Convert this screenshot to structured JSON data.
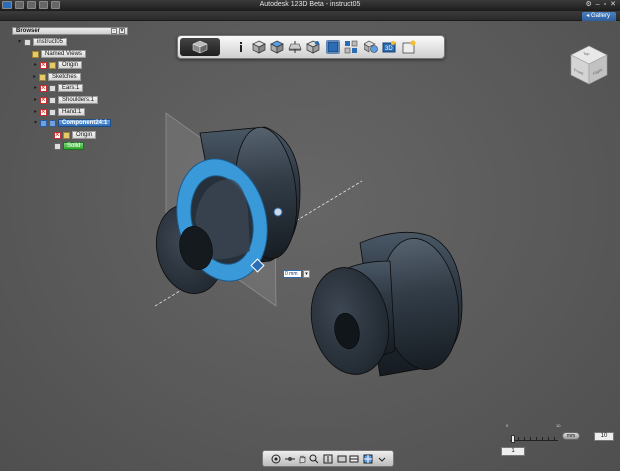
{
  "window": {
    "title": "Autodesk 123D Beta - instruct05",
    "gallery_label": "Gallery"
  },
  "browser": {
    "title": "Browser",
    "items": [
      {
        "label": "instruct05"
      },
      {
        "label": "Named Views"
      },
      {
        "label": "Origin"
      },
      {
        "label": "Sketches"
      },
      {
        "label": "Ears:1"
      },
      {
        "label": "Shoulders:1"
      },
      {
        "label": "Hand:1"
      },
      {
        "label": "Component24:1"
      },
      {
        "label": "Origin"
      },
      {
        "label": "Solid"
      }
    ]
  },
  "viewcube": {
    "faces": [
      "Top",
      "Front",
      "Right"
    ]
  },
  "dimension_input": {
    "value": "0 mm"
  },
  "units": {
    "slider_min": "0",
    "slider_max": "10",
    "unit_badge": "mm",
    "max_field": "10",
    "value_field": "1"
  },
  "colors": {
    "accent": "#2b6cb5",
    "selection_ring": "#3a9ad9",
    "solid_green": "#2fa62d"
  }
}
